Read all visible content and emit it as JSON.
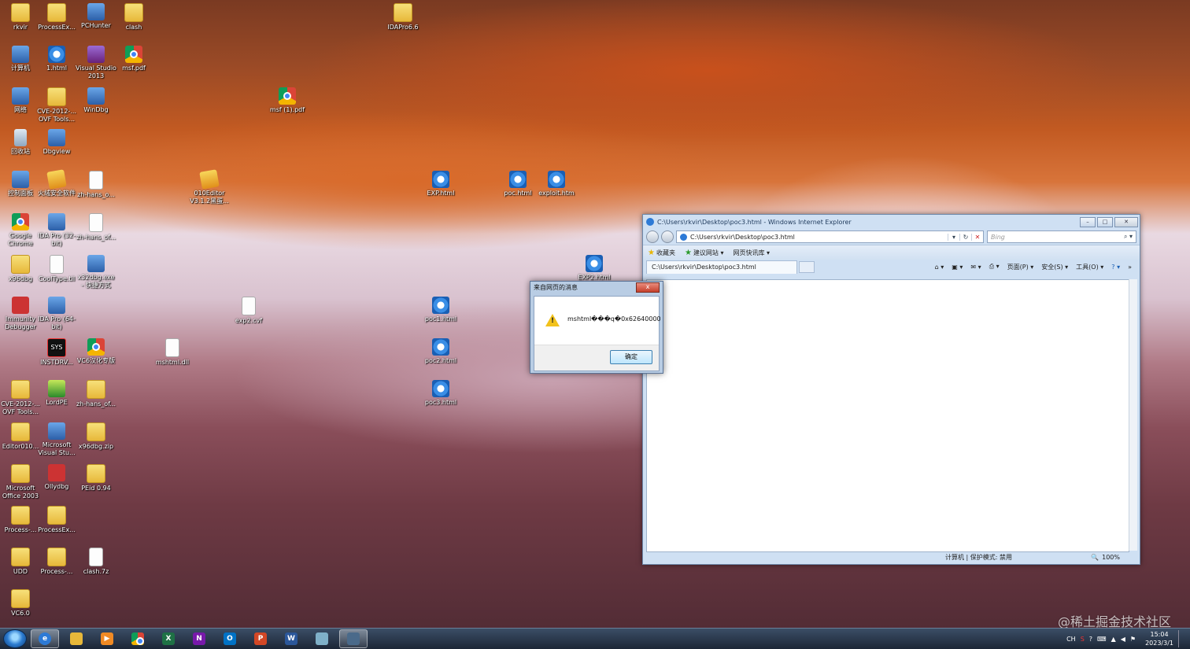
{
  "desktop_icons": [
    {
      "label": "rkvir"
    },
    {
      "label": "ProcessEx..."
    },
    {
      "label": "PCHunter"
    },
    {
      "label": "clash"
    },
    {
      "label": "IDAPro6.6"
    },
    {
      "label": "计算机"
    },
    {
      "label": "1.html"
    },
    {
      "label": "Visual Studio 2013"
    },
    {
      "label": "msf.pdf"
    },
    {
      "label": "网络"
    },
    {
      "label": "CVE-2012-... OVF Tools..."
    },
    {
      "label": "WinDbg"
    },
    {
      "label": "msf (1).pdf"
    },
    {
      "label": "回收站"
    },
    {
      "label": "Dbgview"
    },
    {
      "label": "控制面板"
    },
    {
      "label": "火绒安全软件"
    },
    {
      "label": "zh-hans_o..."
    },
    {
      "label": "010Editor V3.1.2黑蛋..."
    },
    {
      "label": "EXP.html"
    },
    {
      "label": "poc.html"
    },
    {
      "label": "exploit.htm"
    },
    {
      "label": "Google Chrome"
    },
    {
      "label": "IDA Pro (32-bit)"
    },
    {
      "label": "zh-hans_of..."
    },
    {
      "label": "x96dbg"
    },
    {
      "label": "CoolType.til"
    },
    {
      "label": "x32dbg.exe - 快捷方式"
    },
    {
      "label": "EXP2.html"
    },
    {
      "label": "Immunity Debugger"
    },
    {
      "label": "IDA Pro (64-bit)"
    },
    {
      "label": "exp2.cvf"
    },
    {
      "label": "poc1.html"
    },
    {
      "label": "INSTDRV..."
    },
    {
      "label": "VC6汉化专版"
    },
    {
      "label": "mshtml.dll"
    },
    {
      "label": "poc2.html"
    },
    {
      "label": "CVE-2012-... OVF Tools..."
    },
    {
      "label": "LordPE"
    },
    {
      "label": "zh-hans_of..."
    },
    {
      "label": "poc3.html"
    },
    {
      "label": "Editor010..."
    },
    {
      "label": "Microsoft Visual Stu..."
    },
    {
      "label": "x96dbg.zip"
    },
    {
      "label": "Microsoft Office 2003"
    },
    {
      "label": "Ollydbg"
    },
    {
      "label": "PEid 0.94"
    },
    {
      "label": "Process-..."
    },
    {
      "label": "ProcessEx..."
    },
    {
      "label": "UDD"
    },
    {
      "label": "Process-..."
    },
    {
      "label": "clash.7z"
    },
    {
      "label": "VC6.0"
    }
  ],
  "ie": {
    "title": "C:\\Users\\rkvir\\Desktop\\poc3.html - Windows Internet Explorer",
    "address": "C:\\Users\\rkvir\\Desktop\\poc3.html",
    "search_placeholder": "Bing",
    "favorites": "收藏夹",
    "suggested": "建议网站 ▾",
    "slices": "网页快讯库 ▾",
    "tab": "C:\\Users\\rkvir\\Desktop\\poc3.html",
    "cmd_page": "页面(P) ▾",
    "cmd_safety": "安全(S) ▾",
    "cmd_tools": "工具(O) ▾",
    "status_zone": "计算机 | 保护模式: 禁用",
    "zoom": "100%"
  },
  "dialog": {
    "title": "来自网页的消息",
    "message": "mshtml���q�0x62640000",
    "ok": "确定",
    "close": "x"
  },
  "taskbar": {
    "tray_lang": "CH",
    "time": "15:04",
    "date": "2023/3/1"
  },
  "watermark": "@稀土掘金技术社区"
}
